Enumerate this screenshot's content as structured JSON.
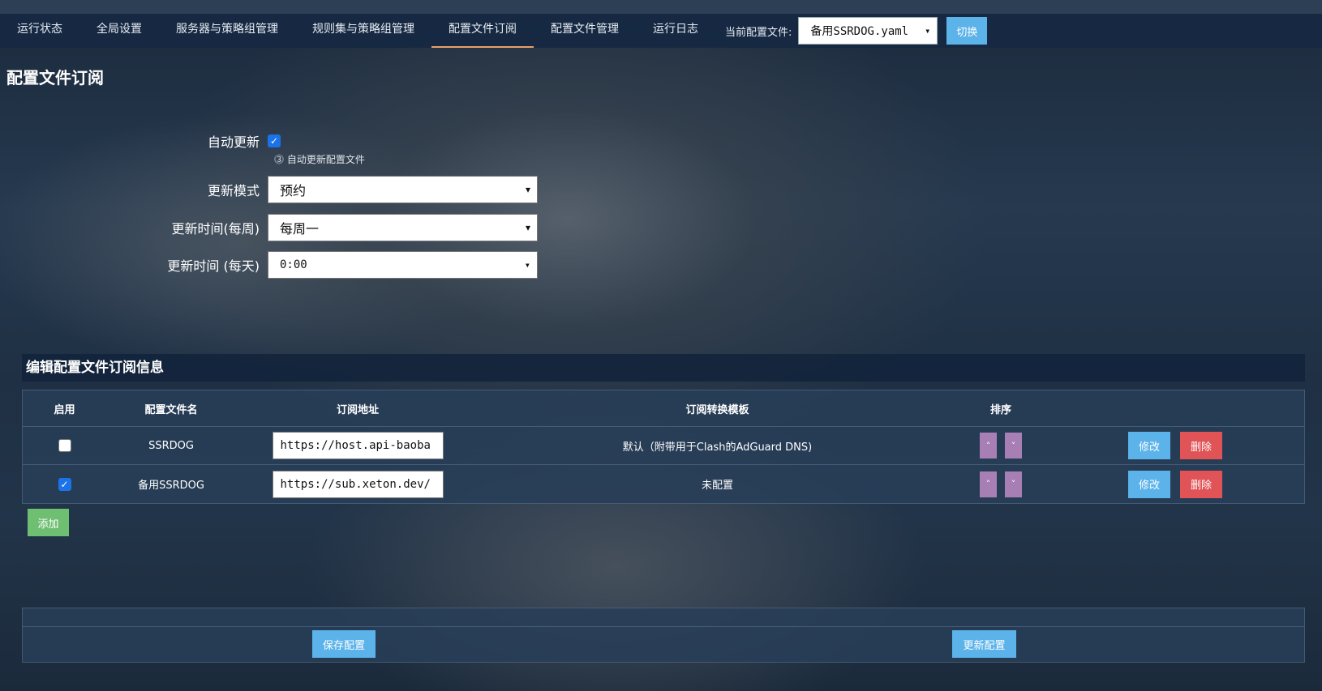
{
  "nav": {
    "items": [
      {
        "label": "运行状态",
        "active": false
      },
      {
        "label": "全局设置",
        "active": false
      },
      {
        "label": "服务器与策略组管理",
        "active": false
      },
      {
        "label": "规则集与策略组管理",
        "active": false
      },
      {
        "label": "配置文件订阅",
        "active": true
      },
      {
        "label": "配置文件管理",
        "active": false
      },
      {
        "label": "运行日志",
        "active": false
      }
    ],
    "current_config_label": "当前配置文件:",
    "current_config_value": "备用SSRDOG.yaml",
    "switch_label": "切换"
  },
  "page": {
    "title": "配置文件订阅"
  },
  "form": {
    "auto_update_label": "自动更新",
    "auto_update_checked": true,
    "auto_update_hint": "⓷ 自动更新配置文件",
    "mode_label": "更新模式",
    "mode_value": "预约",
    "weekly_label": "更新时间(每周)",
    "weekly_value": "每周一",
    "daily_label": "更新时间 (每天)",
    "daily_value": "0:00"
  },
  "subscription": {
    "section_title": "编辑配置文件订阅信息",
    "columns": [
      "启用",
      "配置文件名",
      "订阅地址",
      "订阅转换模板",
      "排序",
      ""
    ],
    "rows": [
      {
        "enabled": false,
        "name": "SSRDOG",
        "url": "https://host.api-baoba",
        "template": "默认（附带用于Clash的AdGuard DNS)",
        "edit": "修改",
        "delete": "删除"
      },
      {
        "enabled": true,
        "name": "备用SSRDOG",
        "url": "https://sub.xeton.dev/",
        "template": "未配置",
        "edit": "修改",
        "delete": "删除"
      }
    ],
    "sort_up": "˄",
    "sort_down": "˅",
    "add_label": "添加"
  },
  "footer": {
    "save_label": "保存配置",
    "update_label": "更新配置"
  },
  "colors": {
    "accent_blue": "#5cb3ea",
    "danger_red": "#e05356",
    "success_green": "#6fbf73",
    "sort_purple": "#a77fb5",
    "active_tab_underline": "#e8a069"
  }
}
